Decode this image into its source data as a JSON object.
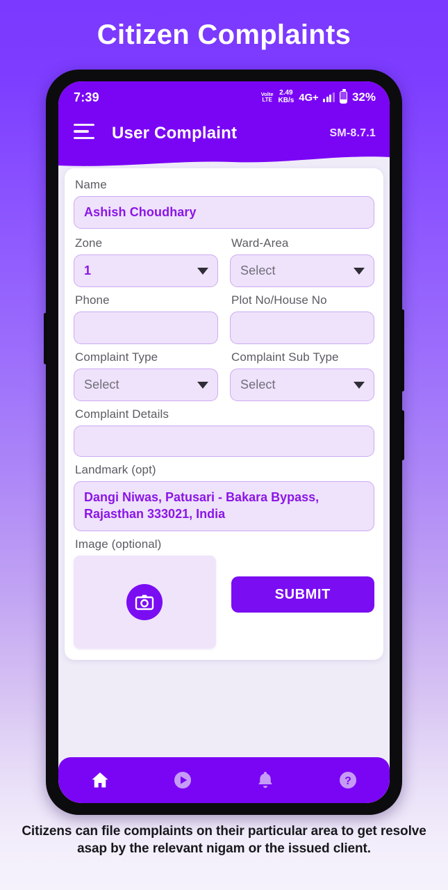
{
  "page": {
    "heading": "Citizen Complaints",
    "caption": "Citizens can file complaints on their particular area to get resolve asap by the relevant nigam or the issued client.",
    "accent_color": "#7a05f5",
    "input_bg_color": "#efe2fb",
    "input_border_color": "#cbaaf2",
    "input_text_color": "#8a16e6",
    "background_gradient_from": "#7b38ff",
    "background_gradient_to": "#f5f2fc"
  },
  "status_bar": {
    "time": "7:39",
    "volte_top": "Volte",
    "volte_bottom": "LTE",
    "net_speed_value": "2.49",
    "net_speed_unit": "KB/s",
    "network_type": "4G+",
    "battery_percent": "32%"
  },
  "app_bar": {
    "menu_icon": "hamburger-icon",
    "title": "User Complaint",
    "version": "SM-8.7.1"
  },
  "form": {
    "name": {
      "label": "Name",
      "value": "Ashish Choudhary",
      "placeholder": ""
    },
    "zone": {
      "label": "Zone",
      "value": "1",
      "placeholder": "Select"
    },
    "ward_area": {
      "label": "Ward-Area",
      "value": "Select",
      "placeholder": "Select"
    },
    "phone": {
      "label": "Phone",
      "value": "",
      "placeholder": ""
    },
    "plot_no": {
      "label": "Plot No/House No",
      "value": "",
      "placeholder": ""
    },
    "complaint_type": {
      "label": "Complaint Type",
      "value": "Select",
      "placeholder": "Select"
    },
    "complaint_sub_type": {
      "label": "Complaint Sub Type",
      "value": "Select",
      "placeholder": "Select"
    },
    "complaint_details": {
      "label": "Complaint Details",
      "value": "",
      "placeholder": ""
    },
    "landmark": {
      "label": "Landmark (opt)",
      "value": "Dangi Niwas, Patusari - Bakara Bypass, Rajasthan 333021, India",
      "placeholder": ""
    },
    "image": {
      "label": "Image (optional)",
      "picker_icon": "camera-icon"
    },
    "submit_label": "SUBMIT"
  },
  "bottom_nav": {
    "items": [
      {
        "icon": "home-icon",
        "active": true
      },
      {
        "icon": "play-circle-icon",
        "active": false
      },
      {
        "icon": "bell-icon",
        "active": false
      },
      {
        "icon": "help-circle-icon",
        "active": false
      }
    ]
  }
}
